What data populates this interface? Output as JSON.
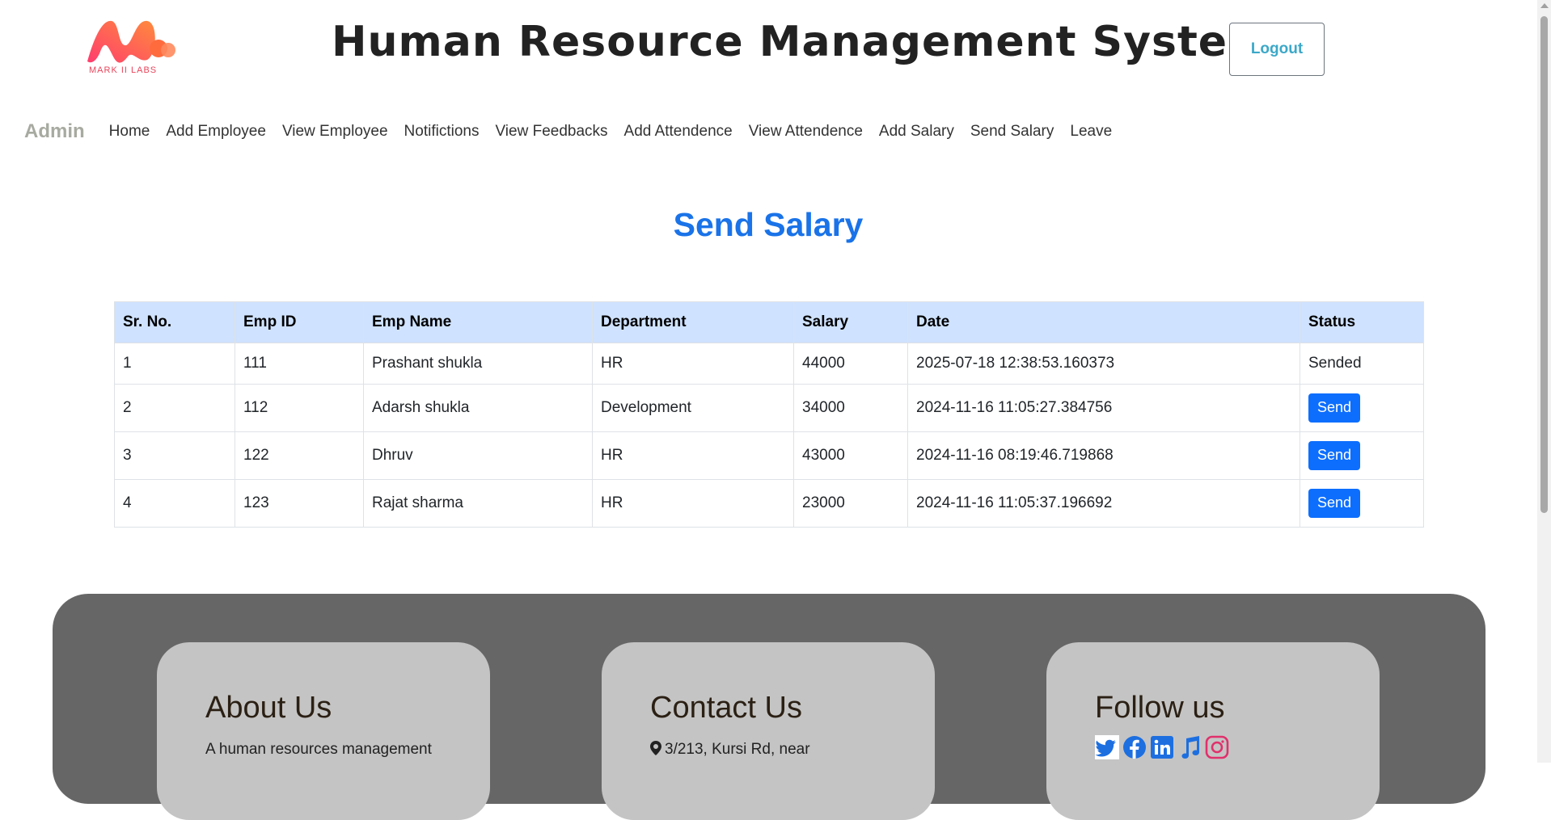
{
  "header": {
    "logo_text": "MARK II LABS",
    "title": "Human Resource Management System",
    "logout_label": "Logout"
  },
  "nav": {
    "brand": "Admin",
    "items": [
      {
        "label": "Home"
      },
      {
        "label": "Add Employee"
      },
      {
        "label": "View Employee"
      },
      {
        "label": "Notifictions"
      },
      {
        "label": "View Feedbacks"
      },
      {
        "label": "Add Attendence"
      },
      {
        "label": "View Attendence"
      },
      {
        "label": "Add Salary"
      },
      {
        "label": "Send Salary"
      },
      {
        "label": "Leave"
      }
    ]
  },
  "page": {
    "title": "Send Salary"
  },
  "table": {
    "headers": [
      "Sr. No.",
      "Emp ID",
      "Emp Name",
      "Department",
      "Salary",
      "Date",
      "Status"
    ],
    "rows": [
      {
        "sr": "1",
        "emp_id": "111",
        "name": "Prashant shukla",
        "department": "HR",
        "salary": "44000",
        "date": "2025-07-18 12:38:53.160373",
        "status": "Sended"
      },
      {
        "sr": "2",
        "emp_id": "112",
        "name": "Adarsh shukla",
        "department": "Development",
        "salary": "34000",
        "date": "2024-11-16 11:05:27.384756",
        "status": "Send"
      },
      {
        "sr": "3",
        "emp_id": "122",
        "name": "Dhruv",
        "department": "HR",
        "salary": "43000",
        "date": "2024-11-16 08:19:46.719868",
        "status": "Send"
      },
      {
        "sr": "4",
        "emp_id": "123",
        "name": "Rajat sharma",
        "department": "HR",
        "salary": "23000",
        "date": "2024-11-16 11:05:37.196692",
        "status": "Send"
      }
    ]
  },
  "footer": {
    "about": {
      "title": "About Us",
      "text": "A human resources management"
    },
    "contact": {
      "title": "Contact Us",
      "text": "3/213, Kursi Rd, near"
    },
    "follow": {
      "title": "Follow us",
      "icons": [
        "twitter-icon",
        "facebook-icon",
        "linkedin-icon",
        "music-icon",
        "instagram-icon"
      ]
    }
  },
  "colors": {
    "accent": "#1a73e8",
    "button": "#0d6efd",
    "table_header": "#cfe2ff",
    "footer_bg": "#666666",
    "card_bg": "#c4c4c4"
  }
}
